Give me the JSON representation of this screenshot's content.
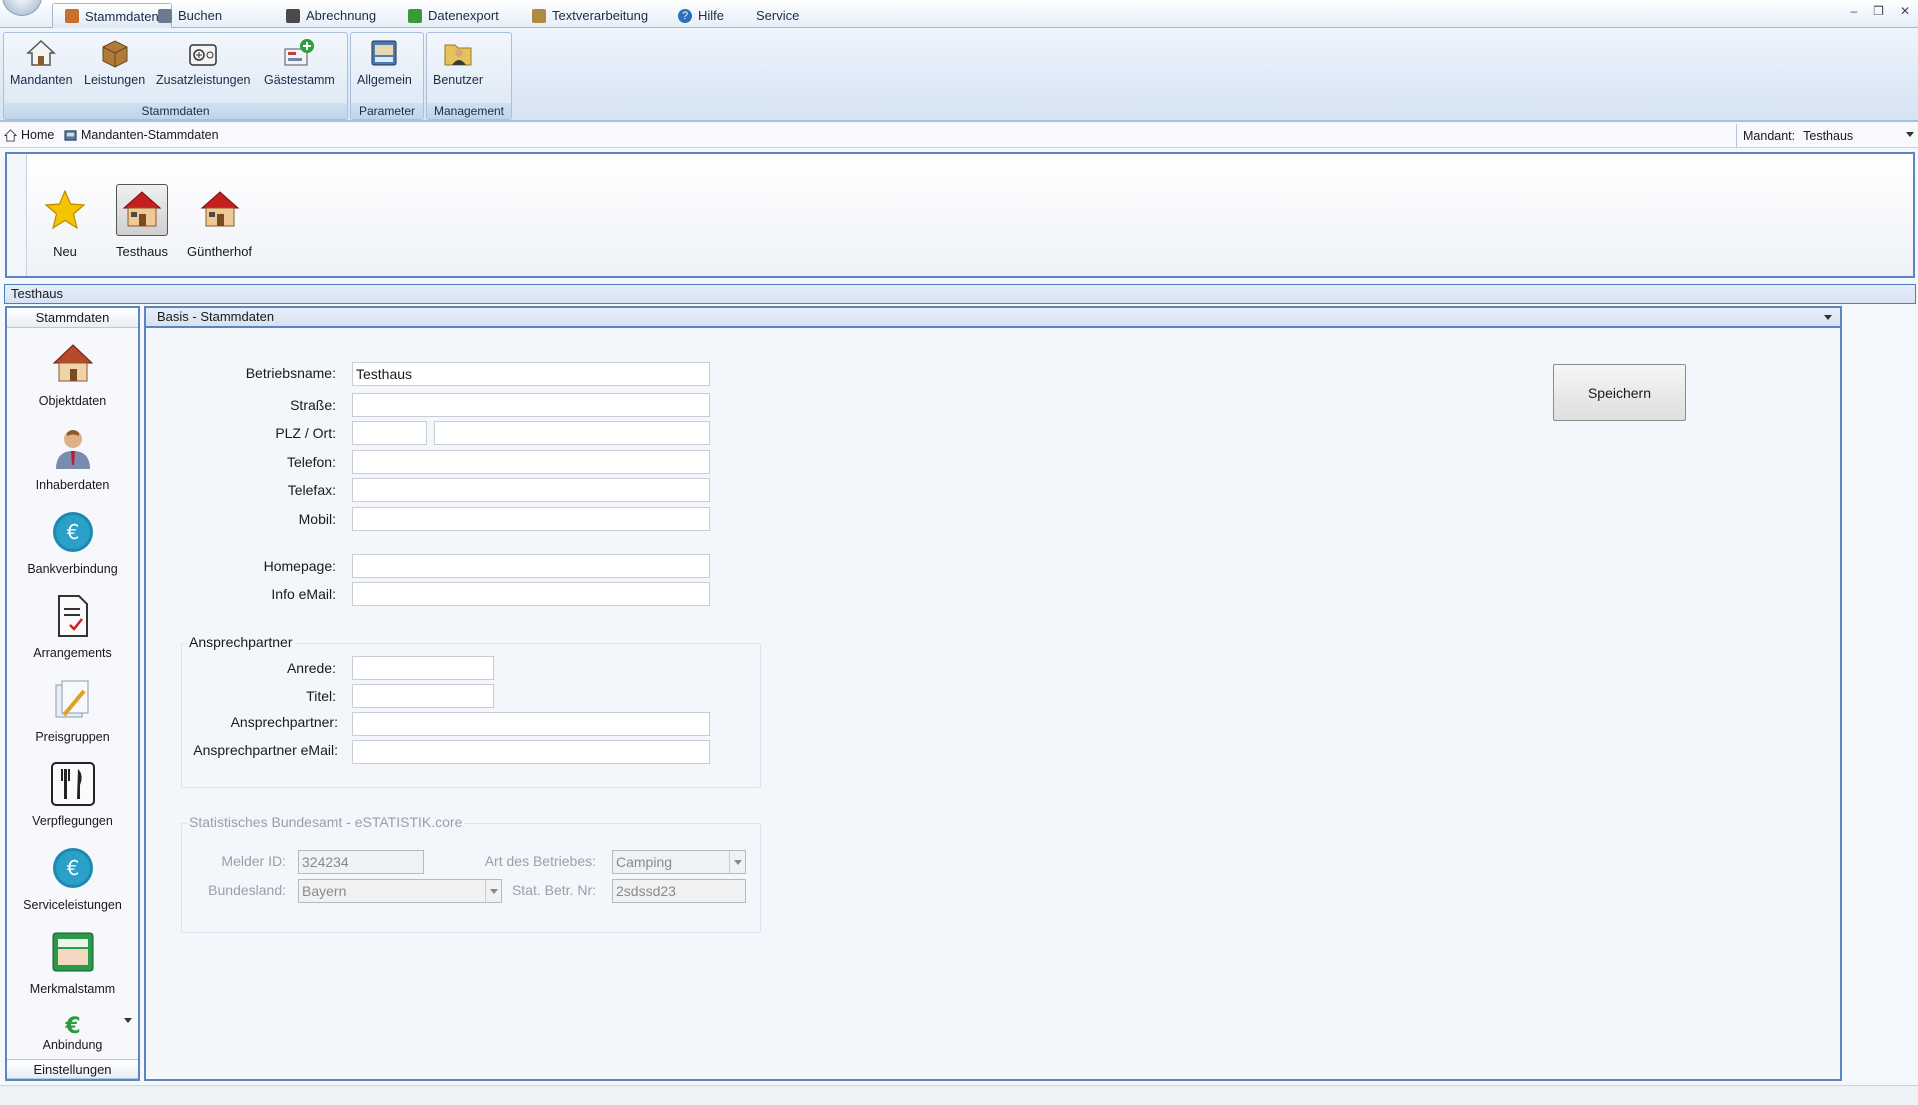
{
  "menu": {
    "tabs": [
      {
        "label": "Stammdaten",
        "icon": "stammdaten-icon"
      },
      {
        "label": "Buchen",
        "icon": "buchen-icon"
      },
      {
        "label": "Abrechnung",
        "icon": "abrechnung-icon"
      },
      {
        "label": "Datenexport",
        "icon": "datenexport-icon"
      },
      {
        "label": "Textverarbeitung",
        "icon": "textverarbeitung-icon"
      },
      {
        "label": "Hilfe",
        "icon": "help-icon"
      },
      {
        "label": "Service",
        "icon": ""
      }
    ],
    "active_tab": "Stammdaten",
    "window_controls": [
      "–",
      "❐",
      "✕"
    ]
  },
  "ribbon": {
    "groups": [
      {
        "label": "Stammdaten",
        "buttons": [
          "Mandanten",
          "Leistungen",
          "Zusatzleistungen",
          "Gästestamm"
        ]
      },
      {
        "label": "Parameter",
        "buttons": [
          "Allgemein"
        ]
      },
      {
        "label": "Management",
        "buttons": [
          "Benutzer"
        ]
      }
    ]
  },
  "breadcrumb": {
    "home": "Home",
    "current": "Mandanten-Stammdaten",
    "mandant_label": "Mandant:",
    "mandant_value": "Testhaus"
  },
  "objects": {
    "items": [
      "Neu",
      "Testhaus",
      "Güntherhof"
    ],
    "selected": "Testhaus"
  },
  "context_title": "Testhaus",
  "leftnav": {
    "header": "Stammdaten",
    "items": [
      "Objektdaten",
      "Inhaberdaten",
      "Bankverbindung",
      "Arrangements",
      "Preisgruppen",
      "Verpflegungen",
      "Serviceleistungen",
      "Merkmalstamm",
      "Anbindung"
    ],
    "footer": "Einstellungen"
  },
  "form": {
    "header": "Basis - Stammdaten",
    "save_label": "Speichern",
    "labels": {
      "betriebsname": "Betriebsname:",
      "strasse": "Straße:",
      "plz_ort": "PLZ / Ort:",
      "telefon": "Telefon:",
      "telefax": "Telefax:",
      "mobil": "Mobil:",
      "homepage": "Homepage:",
      "info_email": "Info eMail:"
    },
    "values": {
      "betriebsname": "Testhaus",
      "strasse": "",
      "plz": "",
      "ort": "",
      "telefon": "",
      "telefax": "",
      "mobil": "",
      "homepage": "",
      "info_email": ""
    },
    "ansprechpartner": {
      "caption": "Ansprechpartner",
      "labels": {
        "anrede": "Anrede:",
        "titel": "Titel:",
        "ansprechpartner": "Ansprechpartner:",
        "email": "Ansprechpartner eMail:"
      },
      "values": {
        "anrede": "",
        "titel": "",
        "ansprechpartner": "",
        "email": ""
      }
    },
    "statistik": {
      "caption": "Statistisches Bundesamt - eSTATISTIK.core",
      "labels": {
        "melder_id": "Melder ID:",
        "bundesland": "Bundesland:",
        "art": "Art des Betriebes:",
        "stat_nr": "Stat. Betr. Nr:"
      },
      "values": {
        "melder_id": "324234",
        "bundesland": "Bayern",
        "art": "Camping",
        "stat_nr": "2sdssd23"
      }
    }
  }
}
